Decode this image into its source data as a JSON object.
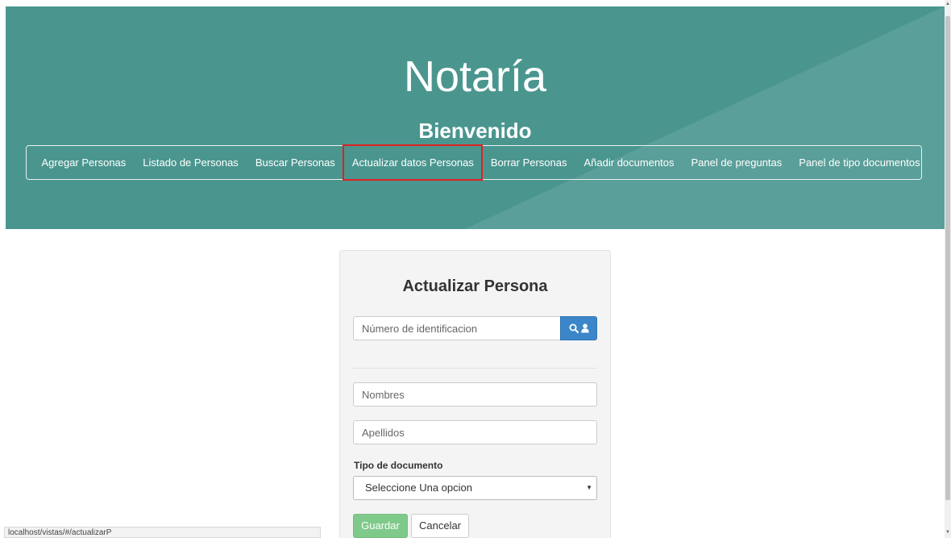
{
  "hero": {
    "title": "Notaría",
    "subtitle": "Bienvenido"
  },
  "nav": {
    "items": [
      {
        "label": "Agregar Personas"
      },
      {
        "label": "Listado de Personas"
      },
      {
        "label": "Buscar Personas"
      },
      {
        "label": "Actualizar datos Personas",
        "active": true
      },
      {
        "label": "Borrar Personas"
      },
      {
        "label": "Añadir documentos"
      },
      {
        "label": "Panel de preguntas"
      },
      {
        "label": "Panel de tipo documentos"
      }
    ]
  },
  "form": {
    "title": "Actualizar Persona",
    "id_placeholder": "Número de identificacion",
    "search_icons": [
      "search-icon",
      "user-icon"
    ],
    "nombres_placeholder": "Nombres",
    "apellidos_placeholder": "Apellidos",
    "doc_type_label": "Tipo de documento",
    "doc_type_selected": "Seleccione Una opcion",
    "save_label": "Guardar",
    "cancel_label": "Cancelar"
  },
  "status_bar": {
    "url": "localhost/vistas/#/actualizarP"
  },
  "colors": {
    "hero_bg": "#4a968f",
    "active_outline": "#e02020",
    "search_button": "#3a86c8",
    "save_button": "#7fc98a",
    "panel_bg": "#f4f4f4"
  }
}
